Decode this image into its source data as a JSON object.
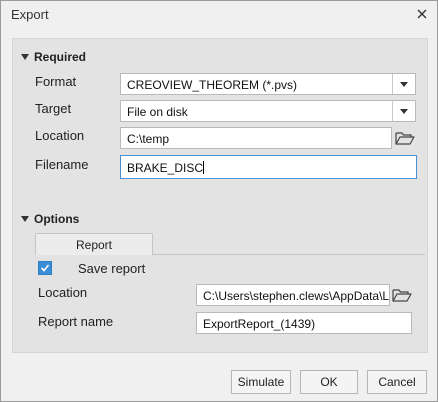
{
  "window": {
    "title": "Export"
  },
  "required": {
    "header": "Required",
    "format": {
      "label": "Format",
      "value": "CREOVIEW_THEOREM (*.pvs)"
    },
    "target": {
      "label": "Target",
      "value": "File on disk"
    },
    "location": {
      "label": "Location",
      "value": "C:\\temp"
    },
    "filename": {
      "label": "Filename",
      "value": "BRAKE_DISC"
    }
  },
  "options": {
    "header": "Options",
    "tab_label": "Report",
    "save_report": {
      "label": "Save report",
      "checked": true
    },
    "location": {
      "label": "Location",
      "value": "C:\\Users\\stephen.clews\\AppData\\L"
    },
    "report_name": {
      "label": "Report name",
      "value": "ExportReport_(1439)"
    }
  },
  "buttons": {
    "simulate": "Simulate",
    "ok": "OK",
    "cancel": "Cancel"
  },
  "colors": {
    "accent": "#3b8ed6",
    "focus_border": "#4a90d9",
    "panel": "#e3e3e3"
  },
  "icons": [
    "close-icon",
    "chevron-down-icon",
    "folder-open-icon",
    "checkmark-icon"
  ]
}
